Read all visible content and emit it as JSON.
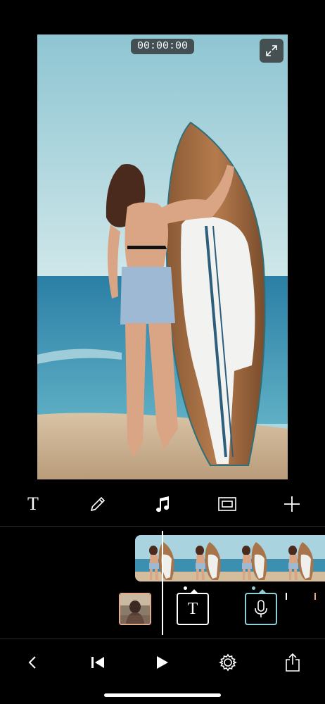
{
  "player": {
    "timecode": "00:00:00",
    "expand_icon": "expand-icon"
  },
  "toolbar": {
    "items": [
      {
        "name": "text",
        "label": "T",
        "icon": "text-icon"
      },
      {
        "name": "draw",
        "icon": "pencil-icon"
      },
      {
        "name": "music",
        "icon": "music-note-icon"
      },
      {
        "name": "layout",
        "icon": "frame-icon"
      },
      {
        "name": "add",
        "icon": "plus-icon"
      }
    ]
  },
  "timeline": {
    "clip_frames": 5,
    "markers": [
      {
        "type": "photo",
        "color": "#e5a98c"
      },
      {
        "type": "text",
        "label": "T",
        "color": "#ffffff"
      },
      {
        "type": "voice",
        "color": "#8fd0d8"
      }
    ],
    "tick_colors": [
      "#ffffff",
      "#e5a98c"
    ]
  },
  "bottombar": {
    "items": [
      "back-icon",
      "skip-to-start-icon",
      "play-icon",
      "settings-icon",
      "share-icon"
    ]
  },
  "colors": {
    "background": "#000000",
    "accent_photo": "#e5a98c",
    "accent_voice": "#8fd0d8"
  }
}
